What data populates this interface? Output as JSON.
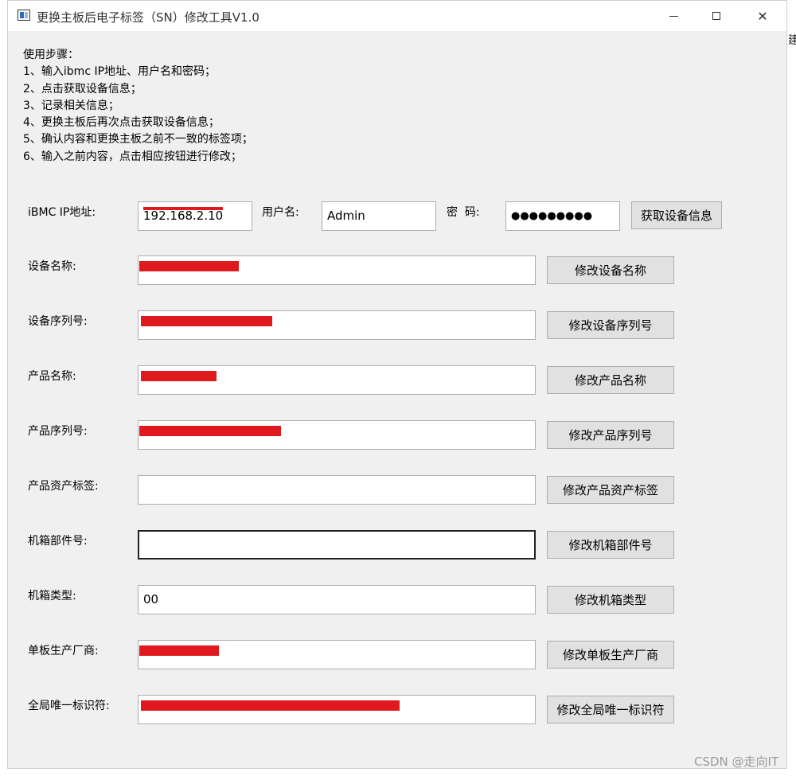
{
  "window": {
    "title": "更换主板后电子标签（SN）修改工具V1.0",
    "close_symbol": "✕"
  },
  "instructions": [
    "使用步骤：",
    "1、输入ibmc IP地址、用户名和密码；",
    "2、点击获取设备信息；",
    "3、记录相关信息；",
    "4、更换主板后再次点击获取设备信息；",
    "5、确认内容和更换主板之前不一致的标签项；",
    "6、输入之前内容，点击相应按钮进行修改；"
  ],
  "login": {
    "ip_label": "iBMC IP地址:",
    "ip_value": "192.168.2.10",
    "user_label": "用户名:",
    "user_value": "Admin",
    "password_label": "密  码:",
    "password_value": "●●●●●●●●●",
    "fetch_button": "获取设备信息"
  },
  "fields": [
    {
      "label": "设备名称:",
      "value": "",
      "button": "修改设备名称"
    },
    {
      "label": "设备序列号:",
      "value": "",
      "button": "修改设备序列号"
    },
    {
      "label": "产品名称:",
      "value": "",
      "button": "修改产品名称"
    },
    {
      "label": "产品序列号:",
      "value": "",
      "button": "修改产品序列号"
    },
    {
      "label": "产品资产标签:",
      "value": "",
      "button": "修改产品资产标签"
    },
    {
      "label": "机箱部件号:",
      "value": "",
      "button": "修改机箱部件号"
    },
    {
      "label": "机箱类型:",
      "value": "00",
      "button": "修改机箱类型"
    },
    {
      "label": "单板生产厂商:",
      "value": "",
      "button": "修改单板生产厂商"
    },
    {
      "label": "全局唯一标识符:",
      "value": "",
      "button": "修改全局唯一标识符"
    }
  ],
  "background_cut_text": "建",
  "watermark": "CSDN @走向IT"
}
